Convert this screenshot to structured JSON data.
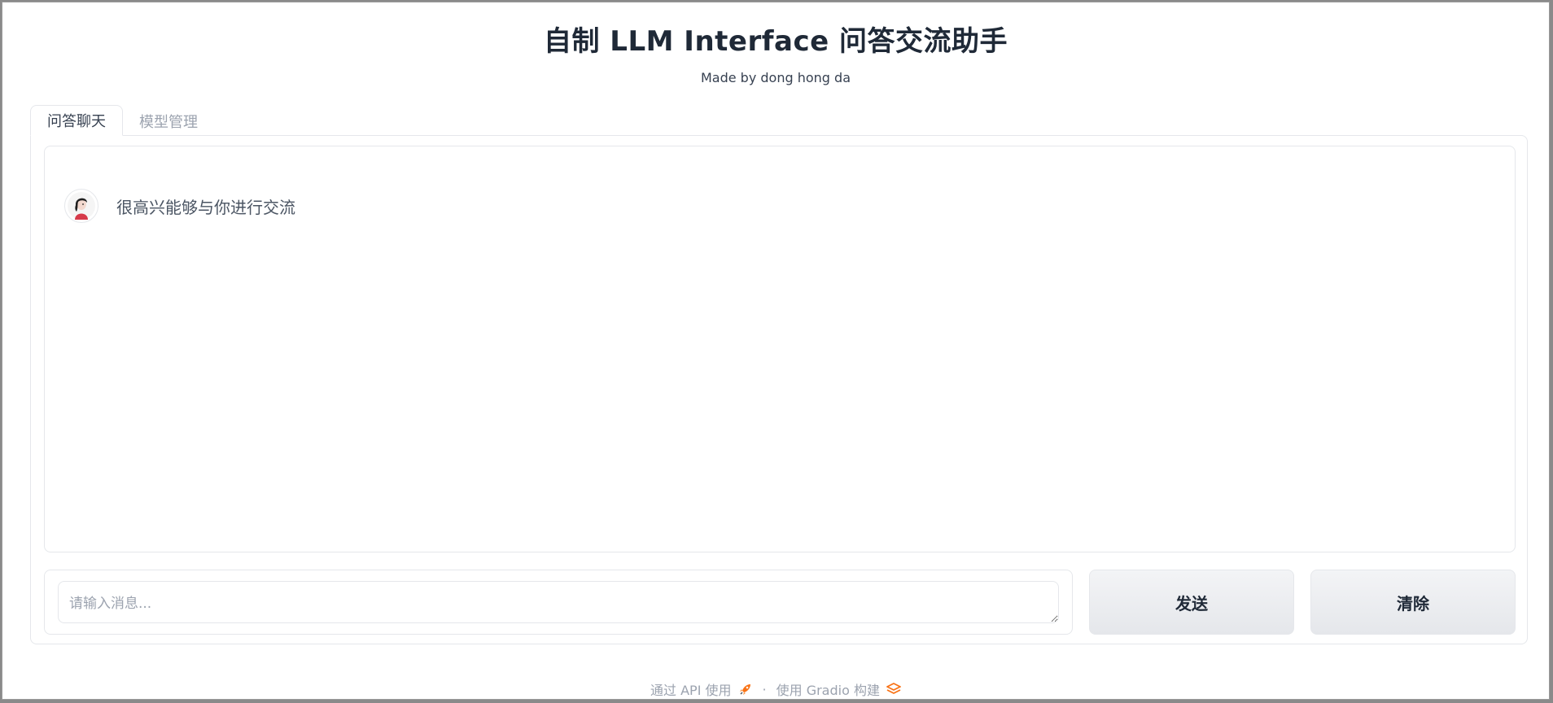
{
  "header": {
    "title": "自制 LLM Interface 问答交流助手",
    "subtitle": "Made by dong hong da"
  },
  "tabs": [
    {
      "label": "问答聊天",
      "active": true
    },
    {
      "label": "模型管理",
      "active": false
    }
  ],
  "chat": {
    "messages": [
      {
        "role": "bot",
        "text": "很高兴能够与你进行交流"
      }
    ]
  },
  "composer": {
    "placeholder": "请输入消息...",
    "value": ""
  },
  "buttons": {
    "send_label": "发送",
    "clear_label": "清除"
  },
  "footer": {
    "api_link": "通过 API 使用",
    "separator": "·",
    "built_with": "使用 Gradio 构建",
    "api_icon": "rocket-icon",
    "gradio_icon": "gradio-logo-icon"
  },
  "colors": {
    "accent": "#f97316",
    "text_primary": "#1f2937",
    "text_muted": "#9ca3af",
    "border": "#e5e7eb"
  }
}
